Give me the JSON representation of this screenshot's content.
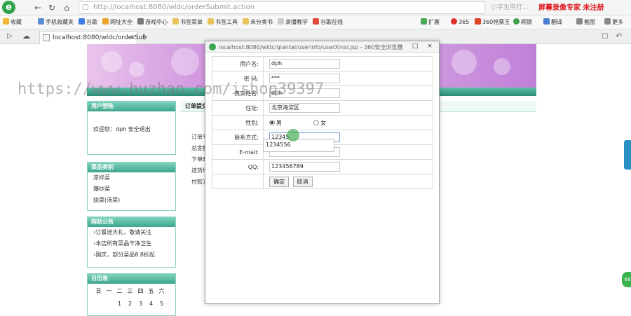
{
  "browser": {
    "logo": "e",
    "url": "http://localhost:8080/wldc/orderSubmit.action",
    "search_placeholder": "小字生用打...",
    "watermark_top_right": "屏幕录像专家 未注册",
    "bookmarks": [
      "收藏",
      "手机收藏夹",
      "谷歌",
      "网址大全",
      "游戏中心",
      "书签菜单",
      "书签工具",
      "未分类书",
      "录播教学",
      "谷歌在线"
    ],
    "toolbar_right": [
      "扩展",
      "365",
      "360抢票王",
      "网银",
      "翻译",
      "截图",
      "更多"
    ],
    "tab_title": "localhost:8080/wldc/orderSub",
    "tab_add": "+"
  },
  "page": {
    "sidebar": [
      {
        "title": "用户登陆",
        "lines": [
          "欢迎您：dph     安全退出"
        ]
      },
      {
        "title": "菜品类别",
        "lines": [
          "凉拌菜",
          "爆炒菜",
          "烧菜(汤菜)"
        ]
      },
      {
        "title": "网站公告",
        "lines": [
          "订餐送大礼，敬请关注",
          "本店所有菜品干净卫生",
          "国庆，部分菜品8.8折起"
        ]
      },
      {
        "title": "日历表",
        "lines": []
      }
    ],
    "calendar_days": [
      "日",
      "一",
      "二",
      "三",
      "四",
      "五",
      "六"
    ],
    "calendar_nums": [
      "",
      "",
      "1",
      "2",
      "3",
      "4",
      "5"
    ],
    "main_title": "订单提交",
    "main_labels": [
      "订单号",
      "总金额",
      "下单时",
      "送货地",
      "付款方"
    ]
  },
  "popup": {
    "title": "localhost:8080/wldc/qiantai/userinfo/userXinxi.jsp - 360安全浏览器",
    "fields": [
      {
        "label": "用户名:",
        "value": "dph"
      },
      {
        "label": "密  码:",
        "value": "***"
      },
      {
        "label": "真实姓名:",
        "value": "dph"
      },
      {
        "label": "住址:",
        "value": "北京海淀区"
      },
      {
        "label": "性别:",
        "value": ""
      },
      {
        "label": "联系方式:",
        "value": "12345"
      },
      {
        "label": "E-mail:",
        "value": ""
      },
      {
        "label": "QQ:",
        "value": "123456789"
      }
    ],
    "gender_male": "男",
    "gender_female": "女",
    "autocomplete": "1234556",
    "confirm": "确定",
    "cancel": "取消"
  },
  "watermark": "https://www.huzhan.com/ishop39397"
}
